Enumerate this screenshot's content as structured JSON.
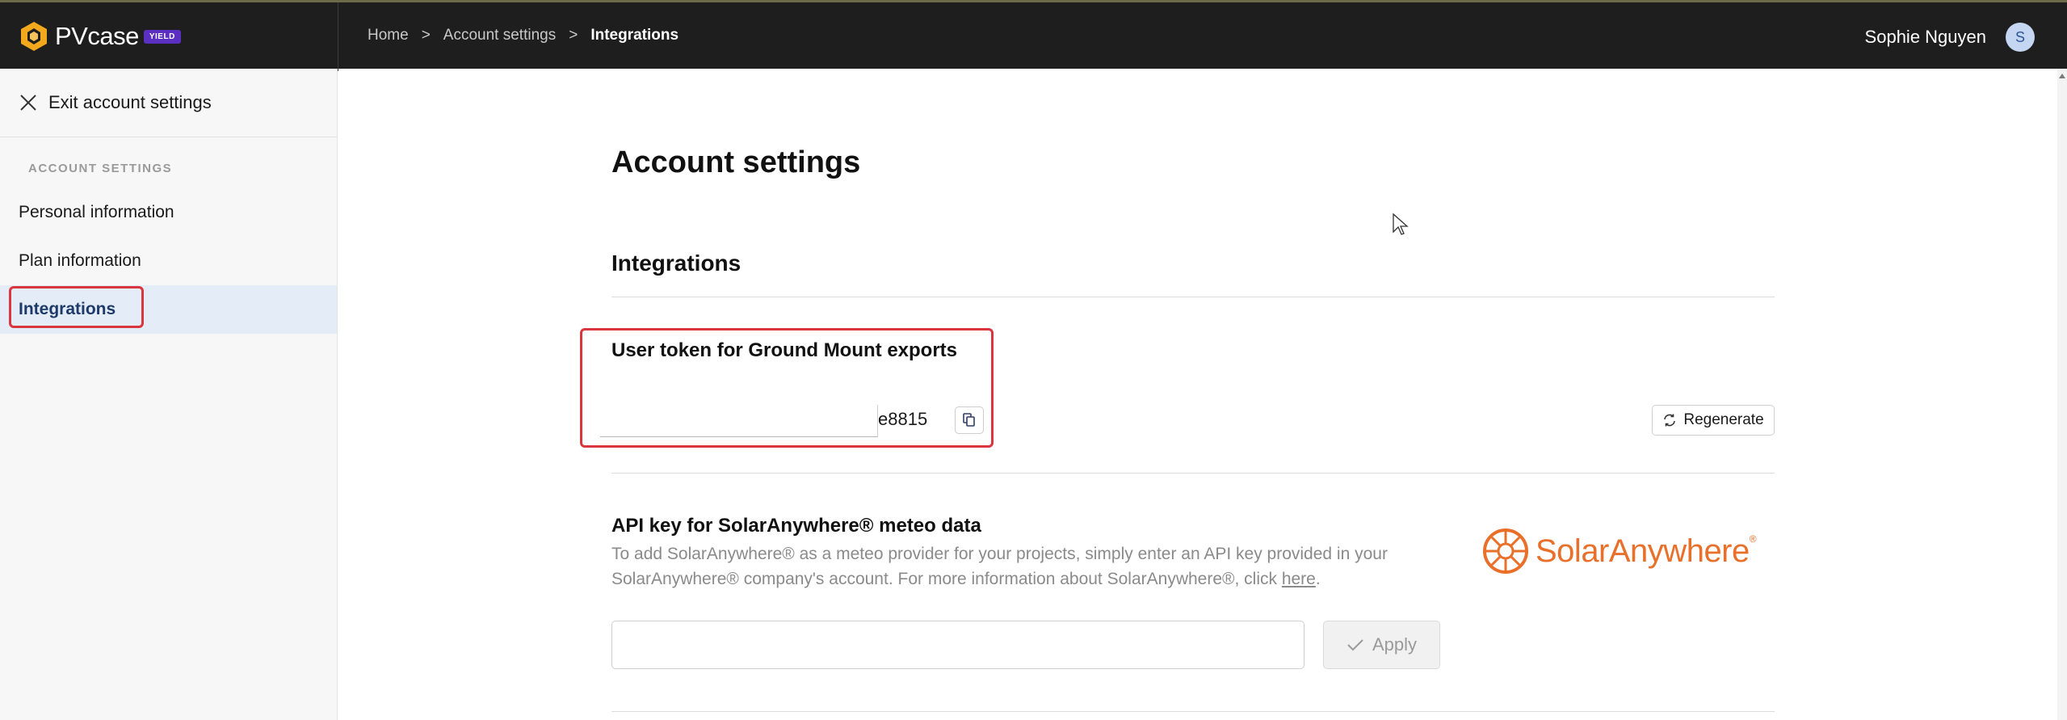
{
  "brand": {
    "name": "PVcase",
    "badge": "YIELD"
  },
  "breadcrumb": {
    "home": "Home",
    "sep1": ">",
    "account": "Account settings",
    "sep2": ">",
    "current": "Integrations"
  },
  "user": {
    "name": "Sophie Nguyen",
    "initial": "S"
  },
  "sidebar": {
    "exit_label": "Exit account settings",
    "section_label": "ACCOUNT SETTINGS",
    "items": [
      {
        "label": "Personal information"
      },
      {
        "label": "Plan information"
      },
      {
        "label": "Integrations",
        "active": true
      }
    ]
  },
  "main": {
    "page_title": "Account settings",
    "section_title": "Integrations",
    "token": {
      "title": "User token for Ground Mount exports",
      "value_suffix": "e8815",
      "regenerate_label": "Regenerate"
    },
    "api": {
      "title": "API key for SolarAnywhere® meteo data",
      "desc_prefix": "To add SolarAnywhere® as a meteo provider for your projects, simply enter an API key provided in your SolarAnywhere® company's account. For more information about SolarAnywhere®, click ",
      "desc_link": "here",
      "desc_suffix": ".",
      "input_value": "",
      "apply_label": "Apply",
      "logo_text": "SolarAnywhere",
      "logo_mark": "®"
    }
  },
  "colors": {
    "accent": "#e8702a",
    "highlight": "#d9363e",
    "topbar": "#1e1e1e",
    "active_bg": "#e3ecf7"
  }
}
